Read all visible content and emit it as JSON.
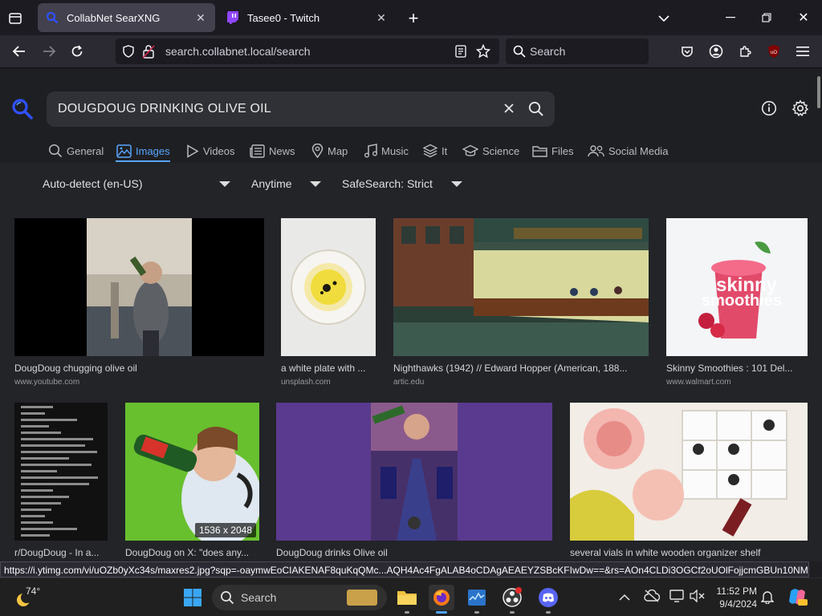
{
  "browser": {
    "tabs": [
      {
        "title": "CollabNet SearXNG",
        "active": true
      },
      {
        "title": "Tasee0 - Twitch",
        "active": false
      }
    ],
    "url": "search.collabnet.local/search",
    "search_placeholder": "Search"
  },
  "search": {
    "query": "DOUGDOUG DRINKING OLIVE OIL",
    "categories": [
      {
        "label": "General",
        "icon": "search-icon"
      },
      {
        "label": "Images",
        "icon": "image-icon",
        "active": true
      },
      {
        "label": "Videos",
        "icon": "play-icon"
      },
      {
        "label": "News",
        "icon": "newspaper-icon"
      },
      {
        "label": "Map",
        "icon": "map-pin-icon"
      },
      {
        "label": "Music",
        "icon": "music-note-icon"
      },
      {
        "label": "It",
        "icon": "layers-icon"
      },
      {
        "label": "Science",
        "icon": "graduation-cap-icon"
      },
      {
        "label": "Files",
        "icon": "folder-icon"
      },
      {
        "label": "Social Media",
        "icon": "users-icon"
      }
    ],
    "filters": {
      "language": "Auto-detect (en-US)",
      "time": "Anytime",
      "safesearch": "SafeSearch: Strict"
    }
  },
  "results": [
    {
      "title": "DougDoug chugging olive oil",
      "host": "www.youtube.com"
    },
    {
      "title": "a white plate with ...",
      "host": "unsplash.com"
    },
    {
      "title": "Nighthawks (1942) // Edward Hopper (American, 188...",
      "host": "artic.edu"
    },
    {
      "title": "Skinny Smoothies : 101 Del...",
      "host": "www.walmart.com",
      "cover_title_1": "skinny",
      "cover_title_2": "smoothies"
    },
    {
      "title": "r/DougDoug - In a...",
      "host": ""
    },
    {
      "title": "DougDoug on X: \"does any...",
      "host": "",
      "dimensions": "1536 x 2048"
    },
    {
      "title": "DougDoug drinks Olive oil",
      "host": ""
    },
    {
      "title": "several vials in white wooden organizer shelf",
      "host": ""
    }
  ],
  "status_link": "https://i.ytimg.com/vi/uOZb0yXc34s/maxres2.jpg?sqp=-oaymwEoCIAKENAF8quKqQMc...AQH4Ac4FgALAB4oCDAgAEAEYZSBcKFIwDw==&rs=AOn4CLDi3OGCf2oUOlFojjcmGBUn10NM9w",
  "taskbar": {
    "weather_temp": "74°",
    "search_label": "Search",
    "time": "11:52 PM",
    "date": "9/4/2024"
  },
  "colors": {
    "accent": "#58a6ff",
    "page_bg": "#222428",
    "header_bg": "#1e1f23",
    "tab_active": "#42414d"
  }
}
